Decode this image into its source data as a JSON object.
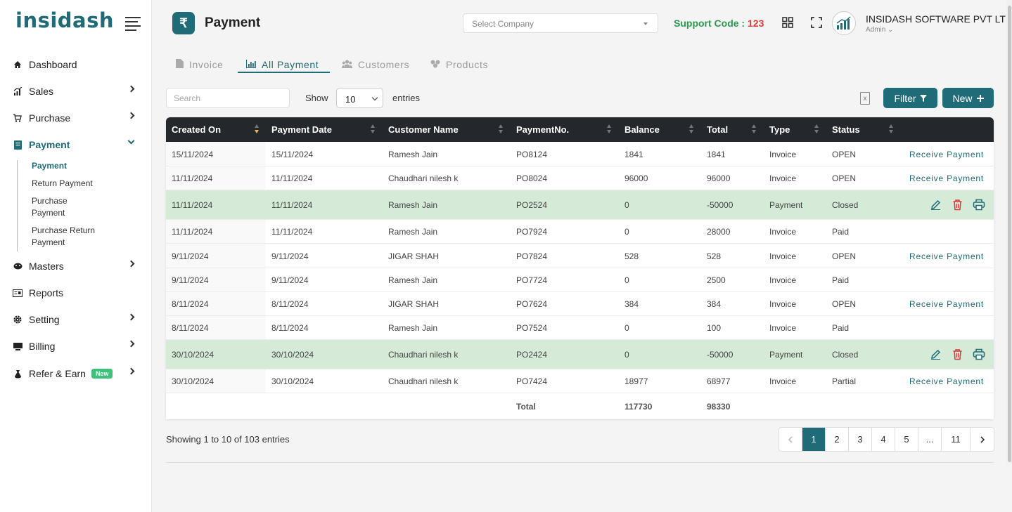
{
  "brand": {
    "logo_text": "insidash",
    "accent": "#1f6b78"
  },
  "sidebar": {
    "items": [
      {
        "label": "Dashboard",
        "icon": "home-icon"
      },
      {
        "label": "Sales",
        "icon": "chart-icon"
      },
      {
        "label": "Purchase",
        "icon": "cart-icon"
      },
      {
        "label": "Payment",
        "icon": "book-icon"
      },
      {
        "label": "Masters",
        "icon": "masters-icon"
      },
      {
        "label": "Reports",
        "icon": "reports-icon"
      },
      {
        "label": "Setting",
        "icon": "gear-icon"
      },
      {
        "label": "Billing",
        "icon": "billing-icon"
      },
      {
        "label": "Refer & Earn",
        "icon": "gift-icon",
        "badge": "New"
      }
    ],
    "payment_submenu": [
      "Payment",
      "Return Payment",
      "Purchase Payment",
      "Purchase Return Payment"
    ]
  },
  "header": {
    "title": "Payment",
    "company_select_placeholder": "Select Company",
    "support_label": "Support Code : ",
    "support_code": "123",
    "company_name": "INSIDASH SOFTWARE PVT LTD",
    "role": "Admin ⌄"
  },
  "tabs": [
    "Invoice",
    "All Payment",
    "Customers",
    "Products"
  ],
  "toolbar": {
    "search_placeholder": "Search",
    "show_label": "Show",
    "entries_value": "10",
    "entries_label": "entries",
    "filter_label": "Filter",
    "new_label": "New"
  },
  "table": {
    "columns": [
      "Created On",
      "Payment Date",
      "Customer Name",
      "PaymentNo.",
      "Balance",
      "Total",
      "Type",
      "Status"
    ],
    "action_label": "Receive Payment",
    "rows": [
      {
        "created": "15/11/2024",
        "date": "15/11/2024",
        "customer": "Ramesh Jain",
        "no": "PO8124",
        "balance": "1841",
        "total": "1841",
        "type": "Invoice",
        "status": "OPEN",
        "action": "receive"
      },
      {
        "created": "11/11/2024",
        "date": "11/11/2024",
        "customer": "Chaudhari nilesh k",
        "no": "PO8024",
        "balance": "96000",
        "total": "96000",
        "type": "Invoice",
        "status": "OPEN",
        "action": "receive"
      },
      {
        "created": "11/11/2024",
        "date": "11/11/2024",
        "customer": "Ramesh Jain",
        "no": "PO2524",
        "balance": "0",
        "total": "-50000",
        "type": "Payment",
        "status": "Closed",
        "action": "icons"
      },
      {
        "created": "11/11/2024",
        "date": "11/11/2024",
        "customer": "Ramesh Jain",
        "no": "PO7924",
        "balance": "0",
        "total": "28000",
        "type": "Invoice",
        "status": "Paid",
        "action": "none"
      },
      {
        "created": "9/11/2024",
        "date": "9/11/2024",
        "customer": "JIGAR SHAH",
        "no": "PO7824",
        "balance": "528",
        "total": "528",
        "type": "Invoice",
        "status": "OPEN",
        "action": "receive"
      },
      {
        "created": "9/11/2024",
        "date": "9/11/2024",
        "customer": "Ramesh Jain",
        "no": "PO7724",
        "balance": "0",
        "total": "2500",
        "type": "Invoice",
        "status": "Paid",
        "action": "none"
      },
      {
        "created": "8/11/2024",
        "date": "8/11/2024",
        "customer": "JIGAR SHAH",
        "no": "PO7624",
        "balance": "384",
        "total": "384",
        "type": "Invoice",
        "status": "OPEN",
        "action": "receive"
      },
      {
        "created": "8/11/2024",
        "date": "8/11/2024",
        "customer": "Ramesh Jain",
        "no": "PO7524",
        "balance": "0",
        "total": "100",
        "type": "Invoice",
        "status": "Paid",
        "action": "none"
      },
      {
        "created": "30/10/2024",
        "date": "30/10/2024",
        "customer": "Chaudhari nilesh k",
        "no": "PO2424",
        "balance": "0",
        "total": "-50000",
        "type": "Payment",
        "status": "Closed",
        "action": "icons"
      },
      {
        "created": "30/10/2024",
        "date": "30/10/2024",
        "customer": "Chaudhari nilesh k",
        "no": "PO7424",
        "balance": "18977",
        "total": "68977",
        "type": "Invoice",
        "status": "Partial",
        "action": "receive"
      }
    ],
    "totals": {
      "label": "Total",
      "balance": "117730",
      "total": "98330"
    }
  },
  "footer": {
    "showing": "Showing 1 to 10 of 103 entries",
    "pages": [
      "1",
      "2",
      "3",
      "4",
      "5",
      "...",
      "11"
    ],
    "current_page": "1"
  }
}
